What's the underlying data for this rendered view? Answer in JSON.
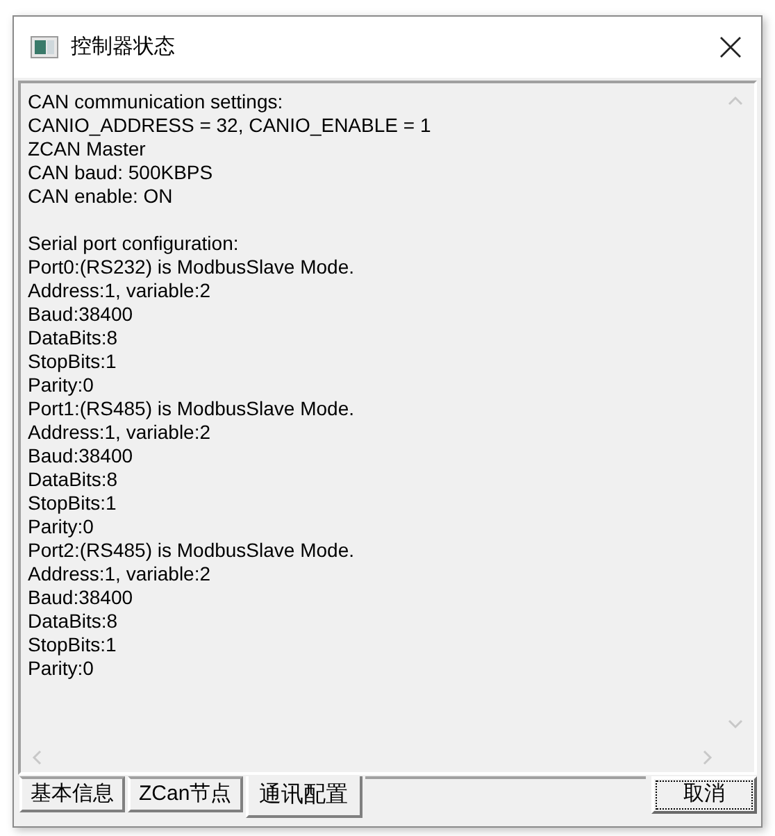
{
  "window": {
    "title": "控制器状态"
  },
  "text_paragraphs": [
    [
      "CAN communication settings:",
      "CANIO_ADDRESS = 32, CANIO_ENABLE = 1",
      "ZCAN Master",
      "CAN baud: 500KBPS",
      "CAN enable: ON"
    ],
    [
      "Serial port configuration:",
      "Port0:(RS232) is ModbusSlave Mode.",
      "Address:1, variable:2",
      "Baud:38400",
      "DataBits:8",
      "StopBits:1",
      "Parity:0",
      "Port1:(RS485) is ModbusSlave Mode.",
      "Address:1, variable:2",
      "Baud:38400",
      "DataBits:8",
      "StopBits:1",
      "Parity:0",
      "Port2:(RS485) is ModbusSlave Mode.",
      "Address:1, variable:2",
      "Baud:38400",
      "DataBits:8",
      "StopBits:1",
      "Parity:0"
    ]
  ],
  "tabs": [
    {
      "label": "基本信息",
      "selected": false
    },
    {
      "label": "ZCan节点",
      "selected": false
    },
    {
      "label": "通讯配置",
      "selected": true
    }
  ],
  "buttons": [
    {
      "label": "取消",
      "focused": true
    }
  ]
}
